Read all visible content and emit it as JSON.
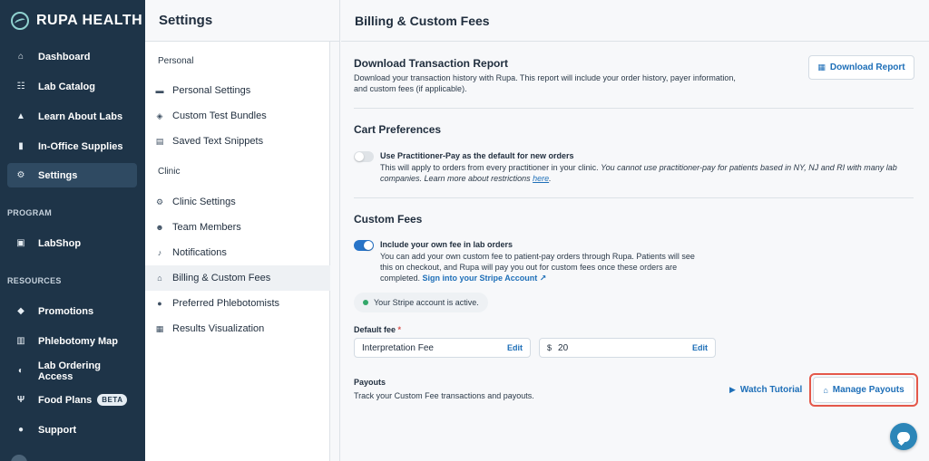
{
  "brand": {
    "name": "RUPA HEALTH"
  },
  "sidebar": {
    "items": [
      {
        "label": "Dashboard",
        "icon": "home-icon"
      },
      {
        "label": "Lab Catalog",
        "icon": "catalog-icon"
      },
      {
        "label": "Learn About Labs",
        "icon": "graduation-cap-icon"
      },
      {
        "label": "In-Office Supplies",
        "icon": "supplies-icon"
      },
      {
        "label": "Settings",
        "icon": "gear-icon",
        "active": true
      }
    ],
    "program_label": "PROGRAM",
    "program_items": [
      {
        "label": "LabShop",
        "icon": "shop-icon"
      }
    ],
    "resources_label": "RESOURCES",
    "resource_items": [
      {
        "label": "Promotions",
        "icon": "tag-icon"
      },
      {
        "label": "Phlebotomy Map",
        "icon": "map-icon"
      },
      {
        "label": "Lab Ordering Access",
        "icon": "shield-icon"
      },
      {
        "label": "Food Plans",
        "icon": "utensils-icon",
        "badge": "BETA"
      },
      {
        "label": "Support",
        "icon": "chat-icon"
      }
    ]
  },
  "settings": {
    "title": "Settings",
    "personal_label": "Personal",
    "personal_items": [
      {
        "label": "Personal Settings",
        "icon": "id-card-icon"
      },
      {
        "label": "Custom Test Bundles",
        "icon": "layers-icon"
      },
      {
        "label": "Saved Text Snippets",
        "icon": "snippet-icon"
      }
    ],
    "clinic_label": "Clinic",
    "clinic_items": [
      {
        "label": "Clinic Settings",
        "icon": "gear-icon"
      },
      {
        "label": "Team Members",
        "icon": "users-icon"
      },
      {
        "label": "Notifications",
        "icon": "bell-icon"
      },
      {
        "label": "Billing & Custom Fees",
        "icon": "bank-icon",
        "active": true
      },
      {
        "label": "Preferred Phlebotomists",
        "icon": "drop-icon"
      },
      {
        "label": "Results Visualization",
        "icon": "document-icon"
      }
    ]
  },
  "main": {
    "title": "Billing & Custom Fees",
    "report": {
      "title": "Download Transaction Report",
      "desc_1": "Download your transaction history with Rupa. This report will include your order history, payer information,",
      "desc_2": "and custom fees (if applicable).",
      "button": "Download Report"
    },
    "cart": {
      "title": "Cart Preferences",
      "option_title": "Use Practitioner-Pay as the default for new orders",
      "desc_1": "This will apply to orders from every practitioner in your clinic.",
      "desc_1_italic": "You cannot use practitioner-pay for patients based in NY, NJ and RI with many lab",
      "desc_2_italic": "companies. Learn more about restrictions",
      "link": "here",
      "toggle": "off"
    },
    "fees": {
      "title": "Custom Fees",
      "option_title": "Include your own fee in lab orders",
      "desc_1": "You can add your own custom fee to patient-pay orders through Rupa. Patients will see",
      "desc_2": "this on checkout, and Rupa will pay you out for custom fees once these orders are",
      "desc_3": "completed.",
      "link": "Sign into your Stripe Account ↗",
      "toggle": "on",
      "status": "Your Stripe account is active.",
      "default_fee_label": "Default fee",
      "required_mark": "*",
      "fee_name": "Interpretation Fee",
      "fee_edit": "Edit",
      "currency": "$",
      "fee_amount": "20",
      "amount_edit": "Edit"
    },
    "payouts": {
      "title": "Payouts",
      "desc": "Track your Custom Fee transactions and payouts.",
      "watch_tutorial": "Watch Tutorial",
      "manage_payouts": "Manage Payouts"
    }
  },
  "colors": {
    "sidebar_bg": "#1e3448",
    "accent": "#1e6fb8",
    "highlight": "#e4584a",
    "active_status": "#33a86a"
  }
}
